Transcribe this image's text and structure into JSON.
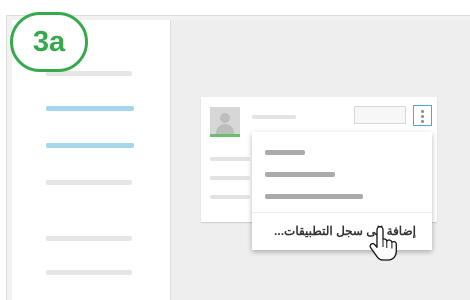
{
  "badge": {
    "label": "3a",
    "color": "#36a94c"
  },
  "sidebar": {
    "items": [
      {
        "active": false
      },
      {
        "active": true
      },
      {
        "active": true
      },
      {
        "active": false
      },
      {
        "active": false
      },
      {
        "active": false
      }
    ],
    "active_color": "#a6d6ec"
  },
  "app_card": {
    "avatar_accent_color": "#6cbd6d",
    "more_button_icon": "kebab-icon"
  },
  "menu": {
    "items": [
      {
        "placeholder": true
      },
      {
        "placeholder": true
      },
      {
        "placeholder": true
      }
    ],
    "action_label": "إضافة إلى سجل التطبيقات..."
  },
  "pointer": {
    "icon": "hand-pointer-icon"
  }
}
